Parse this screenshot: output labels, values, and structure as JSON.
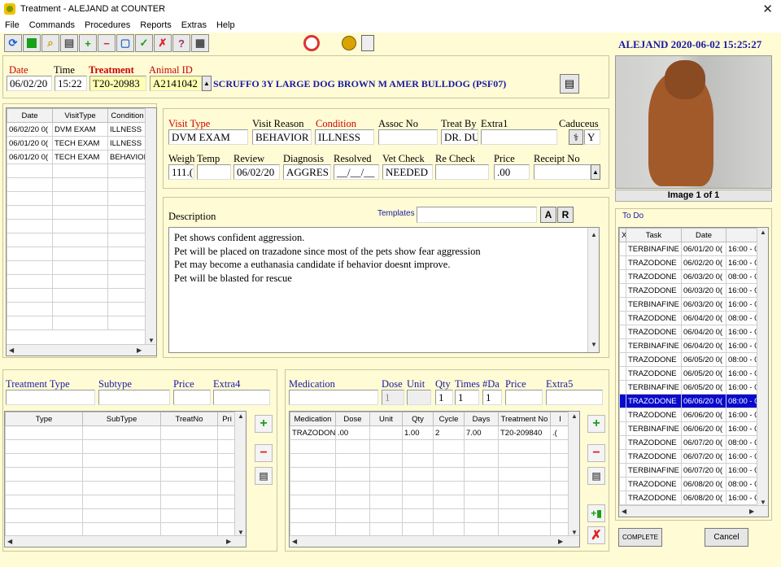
{
  "window": {
    "title": "Treatment  -  ALEJAND at COUNTER"
  },
  "menu": [
    "File",
    "Commands",
    "Procedures",
    "Reports",
    "Extras",
    "Help"
  ],
  "header": {
    "user_datetime": "ALEJAND 2020-06-02 15:25:27"
  },
  "treatment_header": {
    "date_label": "Date",
    "time_label": "Time",
    "treatment_label": "Treatment",
    "animal_label": "Animal ID",
    "date": "06/02/20",
    "time": "15:22",
    "treatment_no": "T20-20983",
    "animal_id": "A2141042",
    "animal_desc": "SCRUFFO 3Y LARGE DOG BROWN M AMER BULLDOG (PSF07)"
  },
  "photo": {
    "caption": "Image 1 of 1"
  },
  "visits": {
    "columns": [
      "Date",
      "VisitType",
      "Condition"
    ],
    "rows": [
      [
        "06/02/20 0(",
        "DVM EXAM",
        "ILLNESS"
      ],
      [
        "06/01/20 0(",
        "TECH EXAM",
        "ILLNESS"
      ],
      [
        "06/01/20 0(",
        "TECH EXAM",
        "BEHAVIOI"
      ]
    ]
  },
  "visit": {
    "visit_type_label": "Visit Type",
    "visit_reason_label": "Visit Reason",
    "condition_label": "Condition",
    "assoc_no_label": "Assoc No",
    "treat_by_label": "Treat By",
    "extra1_label": "Extra1",
    "caduceus_label": "Caduceus",
    "visit_type": "DVM EXAM",
    "visit_reason": "BEHAVIOR",
    "condition": "ILLNESS",
    "assoc_no": "",
    "treat_by": "DR. DU",
    "extra1": "",
    "caduceus": "Y",
    "weight_label": "Weigh",
    "temp_label": "Temp",
    "review_label": "Review",
    "diagnosis_label": "Diagnosis",
    "resolved_label": "Resolved",
    "vet_check_label": "Vet Check",
    "re_check_label": "Re Check",
    "price_label": "Price",
    "receipt_label": "Receipt No",
    "weight": "111.(",
    "temp": "",
    "review": "06/02/20",
    "diagnosis": "AGGRES",
    "resolved": "__/__/__",
    "vet_check": "NEEDED",
    "re_check": "",
    "price": ".00",
    "receipt": ""
  },
  "description": {
    "label": "Description",
    "templates_label": "Templates",
    "a_btn": "A",
    "r_btn": "R",
    "lines": [
      "Pet shows confident aggression.",
      "Pet will be placed on trazadone since most of the pets show fear aggression",
      "Pet may become a euthanasia candidate if behavior doesnt improve.",
      "Pet will be blasted for rescue"
    ]
  },
  "treatment_type": {
    "type_label": "Treatment Type",
    "subtype_label": "Subtype",
    "price_label": "Price",
    "extra4_label": "Extra4",
    "columns": [
      "Type",
      "SubType",
      "TreatNo",
      "Pri"
    ]
  },
  "medication": {
    "medication_label": "Medication",
    "dose_label": "Dose",
    "unit_label": "Unit",
    "qty_label": "Qty",
    "times_label": "Times",
    "days_label": "#Da",
    "price_label": "Price",
    "extra5_label": "Extra5",
    "dose_value": "1",
    "qty_value": "1",
    "times_value": "1",
    "days_value": "1",
    "columns": [
      "Medication",
      "Dose",
      "Unit",
      "Qty",
      "Cycle",
      "Days",
      "Treatment No",
      "I"
    ],
    "rows": [
      [
        "TRAZODON",
        ".00",
        "",
        "1.00",
        "2",
        "7.00",
        "T20-209840",
        ".("
      ]
    ]
  },
  "todo": {
    "label": "To Do",
    "columns": [
      "X",
      "Task",
      "Date",
      ""
    ],
    "rows": [
      [
        "TERBINAFINE",
        "06/01/20 0(",
        "16:00 - 0"
      ],
      [
        "TRAZODONE",
        "06/02/20 0(",
        "16:00 - 0"
      ],
      [
        "TRAZODONE",
        "06/03/20 0(",
        "08:00 - 0"
      ],
      [
        "TRAZODONE",
        "06/03/20 0(",
        "16:00 - 0"
      ],
      [
        "TERBINAFINE",
        "06/03/20 0(",
        "16:00 - 0"
      ],
      [
        "TRAZODONE",
        "06/04/20 0(",
        "08:00 - 0"
      ],
      [
        "TRAZODONE",
        "06/04/20 0(",
        "16:00 - 0"
      ],
      [
        "TERBINAFINE",
        "06/04/20 0(",
        "16:00 - 0"
      ],
      [
        "TRAZODONE",
        "06/05/20 0(",
        "08:00 - 0"
      ],
      [
        "TRAZODONE",
        "06/05/20 0(",
        "16:00 - 0"
      ],
      [
        "TERBINAFINE",
        "06/05/20 0(",
        "16:00 - 0"
      ],
      [
        "TRAZODONE",
        "06/06/20 0(",
        "08:00 - 0"
      ],
      [
        "TRAZODONE",
        "06/06/20 0(",
        "16:00 - 0"
      ],
      [
        "TERBINAFINE",
        "06/06/20 0(",
        "16:00 - 0"
      ],
      [
        "TRAZODONE",
        "06/07/20 0(",
        "08:00 - 0"
      ],
      [
        "TRAZODONE",
        "06/07/20 0(",
        "16:00 - 0"
      ],
      [
        "TERBINAFINE",
        "06/07/20 0(",
        "16:00 - 0"
      ],
      [
        "TRAZODONE",
        "06/08/20 0(",
        "08:00 - 0"
      ],
      [
        "TRAZODONE",
        "06/08/20 0(",
        "16:00 - 0"
      ]
    ],
    "selected_index": 11,
    "complete_label": "COMPLETE",
    "cancel_label": "Cancel"
  }
}
